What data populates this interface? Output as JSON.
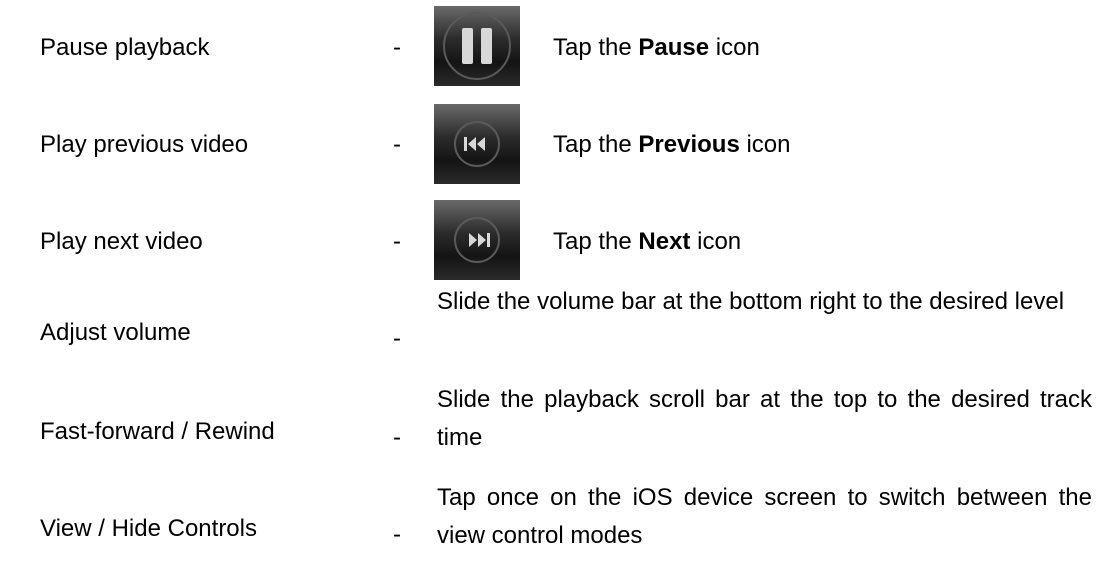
{
  "rows": [
    {
      "action": "Pause playback",
      "dash": "-",
      "icon": "pause-icon",
      "instruction_prefix": "Tap the ",
      "instruction_bold": "Pause",
      "instruction_suffix": " icon"
    },
    {
      "action": "Play previous video",
      "dash": "-",
      "icon": "previous-icon",
      "instruction_prefix": "Tap the ",
      "instruction_bold": "Previous",
      "instruction_suffix": " icon"
    },
    {
      "action": "Play next video",
      "dash": "-",
      "icon": "next-icon",
      "instruction_prefix": "Tap the ",
      "instruction_bold": "Next",
      "instruction_suffix": " icon"
    },
    {
      "action": "Adjust volume",
      "dash": "-",
      "description": "Slide the volume bar at the bottom right to the desired level"
    },
    {
      "action": "Fast-forward / Rewind",
      "dash": "-",
      "description": "Slide the playback scroll bar at the top to the desired track time"
    },
    {
      "action": "View / Hide Controls",
      "dash": "-",
      "description": "Tap once on the iOS device screen to switch between the view control modes"
    }
  ],
  "colors": {
    "text": "#000000",
    "icon_background_dark": "#141414",
    "icon_glyph": "#d8d8d8"
  }
}
